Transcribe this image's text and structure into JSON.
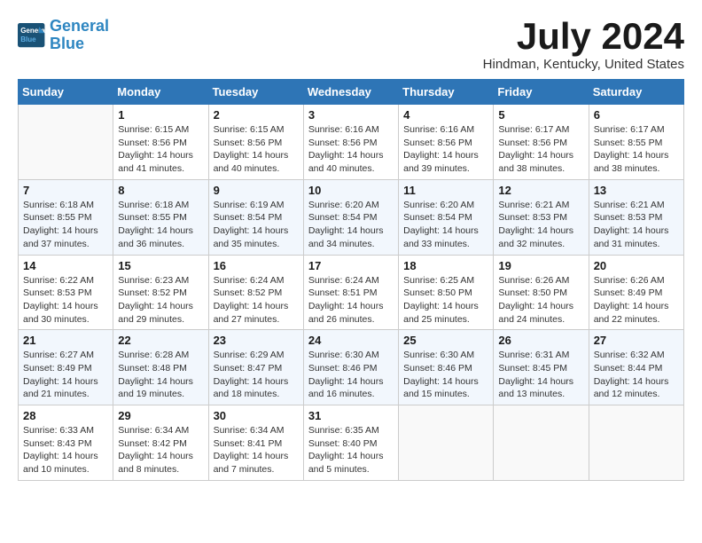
{
  "logo": {
    "line1": "General",
    "line2": "Blue"
  },
  "title": "July 2024",
  "location": "Hindman, Kentucky, United States",
  "weekdays": [
    "Sunday",
    "Monday",
    "Tuesday",
    "Wednesday",
    "Thursday",
    "Friday",
    "Saturday"
  ],
  "weeks": [
    [
      {
        "day": "",
        "info": ""
      },
      {
        "day": "1",
        "info": "Sunrise: 6:15 AM\nSunset: 8:56 PM\nDaylight: 14 hours\nand 41 minutes."
      },
      {
        "day": "2",
        "info": "Sunrise: 6:15 AM\nSunset: 8:56 PM\nDaylight: 14 hours\nand 40 minutes."
      },
      {
        "day": "3",
        "info": "Sunrise: 6:16 AM\nSunset: 8:56 PM\nDaylight: 14 hours\nand 40 minutes."
      },
      {
        "day": "4",
        "info": "Sunrise: 6:16 AM\nSunset: 8:56 PM\nDaylight: 14 hours\nand 39 minutes."
      },
      {
        "day": "5",
        "info": "Sunrise: 6:17 AM\nSunset: 8:56 PM\nDaylight: 14 hours\nand 38 minutes."
      },
      {
        "day": "6",
        "info": "Sunrise: 6:17 AM\nSunset: 8:55 PM\nDaylight: 14 hours\nand 38 minutes."
      }
    ],
    [
      {
        "day": "7",
        "info": "Sunrise: 6:18 AM\nSunset: 8:55 PM\nDaylight: 14 hours\nand 37 minutes."
      },
      {
        "day": "8",
        "info": "Sunrise: 6:18 AM\nSunset: 8:55 PM\nDaylight: 14 hours\nand 36 minutes."
      },
      {
        "day": "9",
        "info": "Sunrise: 6:19 AM\nSunset: 8:54 PM\nDaylight: 14 hours\nand 35 minutes."
      },
      {
        "day": "10",
        "info": "Sunrise: 6:20 AM\nSunset: 8:54 PM\nDaylight: 14 hours\nand 34 minutes."
      },
      {
        "day": "11",
        "info": "Sunrise: 6:20 AM\nSunset: 8:54 PM\nDaylight: 14 hours\nand 33 minutes."
      },
      {
        "day": "12",
        "info": "Sunrise: 6:21 AM\nSunset: 8:53 PM\nDaylight: 14 hours\nand 32 minutes."
      },
      {
        "day": "13",
        "info": "Sunrise: 6:21 AM\nSunset: 8:53 PM\nDaylight: 14 hours\nand 31 minutes."
      }
    ],
    [
      {
        "day": "14",
        "info": "Sunrise: 6:22 AM\nSunset: 8:53 PM\nDaylight: 14 hours\nand 30 minutes."
      },
      {
        "day": "15",
        "info": "Sunrise: 6:23 AM\nSunset: 8:52 PM\nDaylight: 14 hours\nand 29 minutes."
      },
      {
        "day": "16",
        "info": "Sunrise: 6:24 AM\nSunset: 8:52 PM\nDaylight: 14 hours\nand 27 minutes."
      },
      {
        "day": "17",
        "info": "Sunrise: 6:24 AM\nSunset: 8:51 PM\nDaylight: 14 hours\nand 26 minutes."
      },
      {
        "day": "18",
        "info": "Sunrise: 6:25 AM\nSunset: 8:50 PM\nDaylight: 14 hours\nand 25 minutes."
      },
      {
        "day": "19",
        "info": "Sunrise: 6:26 AM\nSunset: 8:50 PM\nDaylight: 14 hours\nand 24 minutes."
      },
      {
        "day": "20",
        "info": "Sunrise: 6:26 AM\nSunset: 8:49 PM\nDaylight: 14 hours\nand 22 minutes."
      }
    ],
    [
      {
        "day": "21",
        "info": "Sunrise: 6:27 AM\nSunset: 8:49 PM\nDaylight: 14 hours\nand 21 minutes."
      },
      {
        "day": "22",
        "info": "Sunrise: 6:28 AM\nSunset: 8:48 PM\nDaylight: 14 hours\nand 19 minutes."
      },
      {
        "day": "23",
        "info": "Sunrise: 6:29 AM\nSunset: 8:47 PM\nDaylight: 14 hours\nand 18 minutes."
      },
      {
        "day": "24",
        "info": "Sunrise: 6:30 AM\nSunset: 8:46 PM\nDaylight: 14 hours\nand 16 minutes."
      },
      {
        "day": "25",
        "info": "Sunrise: 6:30 AM\nSunset: 8:46 PM\nDaylight: 14 hours\nand 15 minutes."
      },
      {
        "day": "26",
        "info": "Sunrise: 6:31 AM\nSunset: 8:45 PM\nDaylight: 14 hours\nand 13 minutes."
      },
      {
        "day": "27",
        "info": "Sunrise: 6:32 AM\nSunset: 8:44 PM\nDaylight: 14 hours\nand 12 minutes."
      }
    ],
    [
      {
        "day": "28",
        "info": "Sunrise: 6:33 AM\nSunset: 8:43 PM\nDaylight: 14 hours\nand 10 minutes."
      },
      {
        "day": "29",
        "info": "Sunrise: 6:34 AM\nSunset: 8:42 PM\nDaylight: 14 hours\nand 8 minutes."
      },
      {
        "day": "30",
        "info": "Sunrise: 6:34 AM\nSunset: 8:41 PM\nDaylight: 14 hours\nand 7 minutes."
      },
      {
        "day": "31",
        "info": "Sunrise: 6:35 AM\nSunset: 8:40 PM\nDaylight: 14 hours\nand 5 minutes."
      },
      {
        "day": "",
        "info": ""
      },
      {
        "day": "",
        "info": ""
      },
      {
        "day": "",
        "info": ""
      }
    ]
  ]
}
